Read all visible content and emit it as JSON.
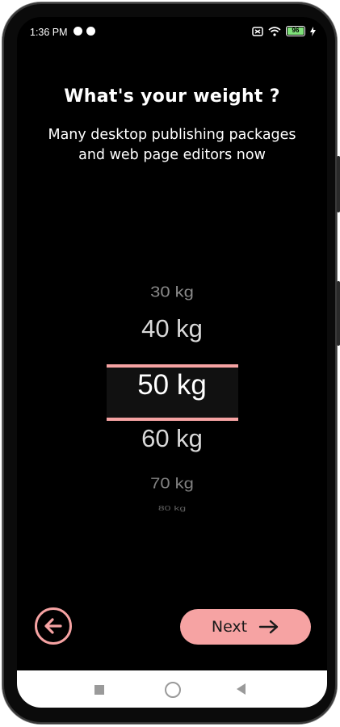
{
  "status_bar": {
    "time": "1:36 PM",
    "battery_level": "96",
    "icons": [
      "vpn-key-icon",
      "wifi-icon",
      "battery-icon",
      "charging-bolt-icon"
    ]
  },
  "screen": {
    "title": "What's your weight ?",
    "subtitle": "Many desktop publishing packages and web page editors now"
  },
  "picker": {
    "options": [
      "30 kg",
      "40 kg",
      "50 kg",
      "60 kg",
      "70 kg",
      "80 kg"
    ],
    "selected": "50 kg"
  },
  "actions": {
    "next_label": "Next"
  },
  "colors": {
    "accent": "#f6a3a3",
    "background": "#000000"
  }
}
